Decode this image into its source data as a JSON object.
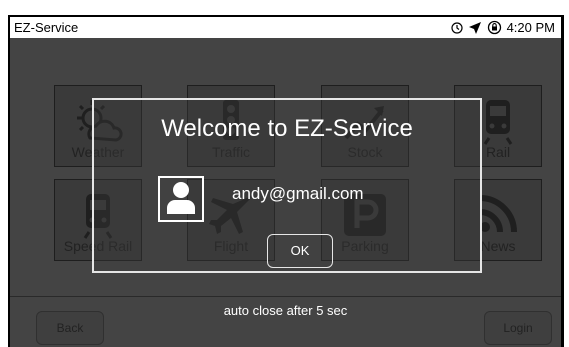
{
  "status_bar": {
    "app_title": "EZ-Service",
    "time": "4:20 PM",
    "icons": [
      "clock-icon",
      "location-arrow-icon",
      "lock-rotation-icon"
    ]
  },
  "tiles": [
    {
      "label": "Weather",
      "icon": "weather-icon"
    },
    {
      "label": "Traffic",
      "icon": "traffic-light-icon"
    },
    {
      "label": "Stock",
      "icon": "stock-chart-icon"
    },
    {
      "label": "Rail",
      "icon": "train-icon"
    },
    {
      "label": "Speed Rail",
      "icon": "speed-rail-icon"
    },
    {
      "label": "Flight",
      "icon": "airplane-icon"
    },
    {
      "label": "Parking",
      "icon": "parking-icon"
    },
    {
      "label": "News",
      "icon": "rss-icon"
    }
  ],
  "dialog": {
    "title": "Welcome to EZ-Service",
    "email": "andy@gmail.com",
    "ok_label": "OK"
  },
  "footer": {
    "auto_close_text": "auto close after 5 sec",
    "back_label": "Back",
    "login_label": "Login"
  }
}
